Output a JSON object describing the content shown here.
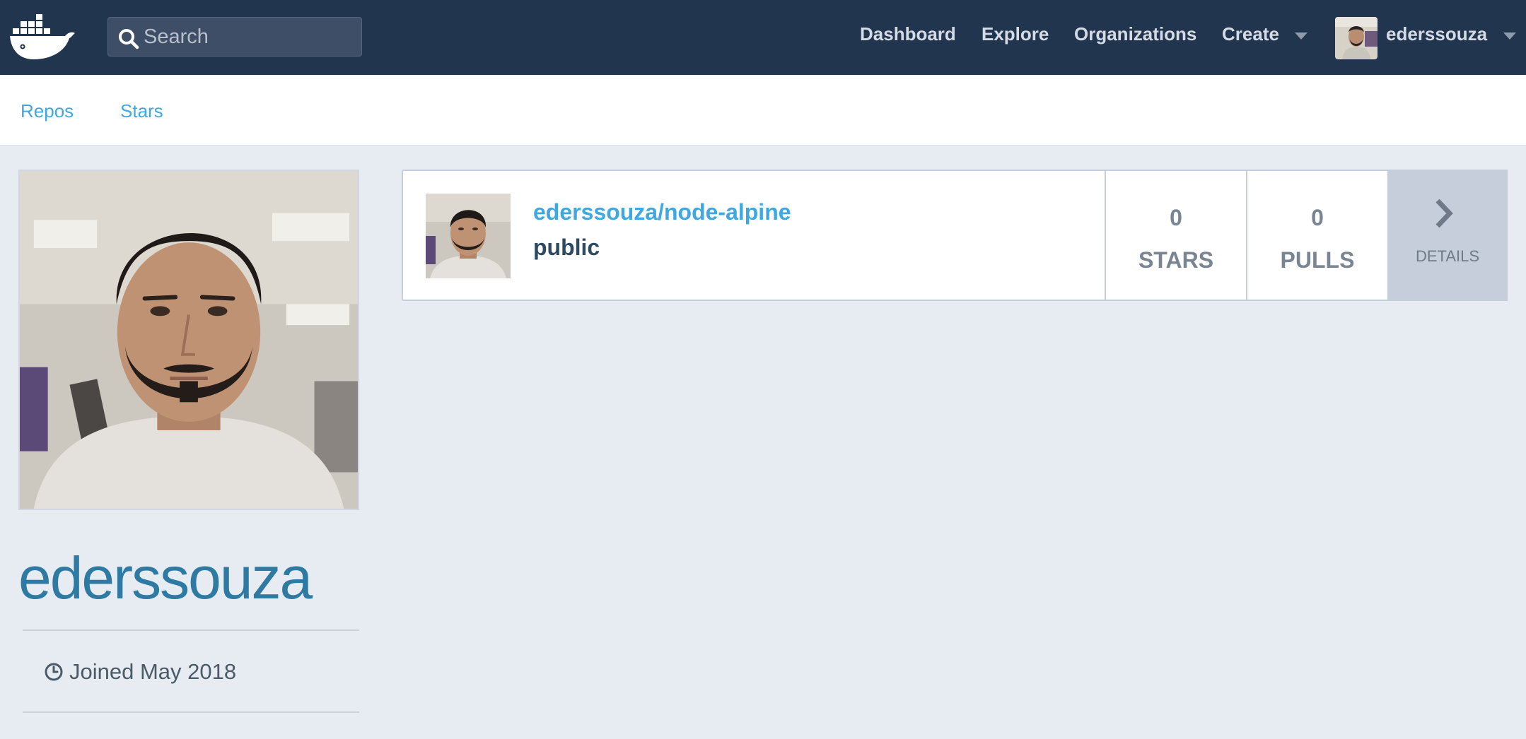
{
  "navbar": {
    "logo": "docker-whale-logo",
    "search": {
      "placeholder": "Search",
      "value": ""
    },
    "links": {
      "dashboard": "Dashboard",
      "explore": "Explore",
      "organizations": "Organizations",
      "create": "Create"
    },
    "user": {
      "username": "ederssouza",
      "avatar": "user-avatar"
    }
  },
  "subnav": {
    "repos": "Repos",
    "stars": "Stars"
  },
  "profile": {
    "username": "ederssouza",
    "joined": "Joined May 2018",
    "joined_icon": "clock-icon"
  },
  "repositories": [
    {
      "name": "ederssouza/node-alpine",
      "visibility": "public",
      "stars": {
        "value": "0",
        "label": "STARS"
      },
      "pulls": {
        "value": "0",
        "label": "PULLS"
      },
      "details_label": "DETAILS"
    }
  ],
  "colors": {
    "navbar": "#22354e",
    "page_background": "#e7ecf3",
    "link": "#3fa8e2",
    "profile_name": "#2f7aa3"
  }
}
